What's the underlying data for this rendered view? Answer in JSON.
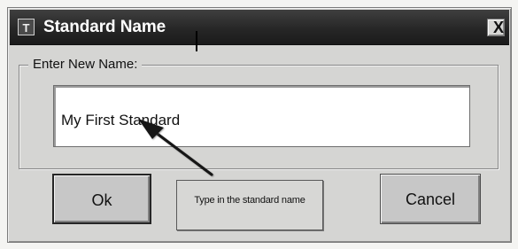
{
  "window": {
    "app_icon": "T",
    "title": "Standard Name",
    "close_glyph": "X"
  },
  "form": {
    "group_label": "Enter New Name:",
    "name_value": "My First Standard"
  },
  "buttons": {
    "ok_label": "Ok",
    "cancel_label": "Cancel"
  },
  "annotation": {
    "callout_text": "Type in the standard name"
  },
  "icons": {
    "app_icon": "t-app-icon",
    "close_icon": "close-x-icon",
    "arrow_icon": "callout-arrow-icon"
  },
  "colors": {
    "titlebar": "#252525",
    "dialog_background": "#d5d5d3",
    "input_background": "#ffffff"
  }
}
